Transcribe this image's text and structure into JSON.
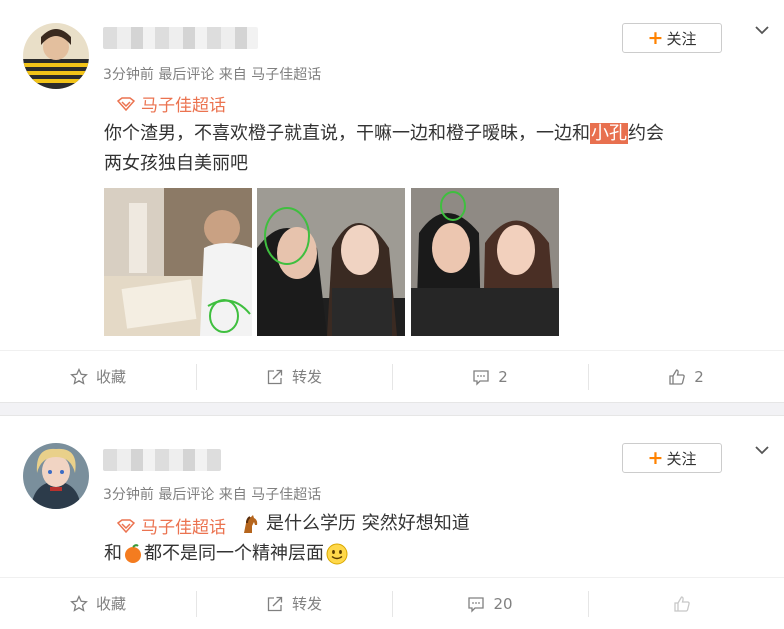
{
  "post1": {
    "meta": "3分钟前 最后评论 来自 马子佳超话",
    "follow_label": "关注",
    "topic": "马子佳超话",
    "text_line1_a": "你个渣男，不喜欢橙子就直说，干嘛一边和橙子暧昧，一边和",
    "text_line1_hl": "小孔",
    "text_line1_b": "约会",
    "text_line2": "两女孩独自美丽吧",
    "actions": {
      "collect": "收藏",
      "repost": "转发",
      "comment_count": "2",
      "like_count": "2"
    }
  },
  "post2": {
    "meta": "3分钟前 最后评论 来自 马子佳超话",
    "follow_label": "关注",
    "topic": "马子佳超话",
    "text_line1": "是什么学历 突然好想知道",
    "text_line2_a": "和",
    "text_line2_b": "都不是同一个精神层面",
    "actions": {
      "collect": "收藏",
      "repost": "转发",
      "comment_count": "20"
    }
  },
  "colors": {
    "accent": "#ff8200",
    "topic": "#eb7350",
    "highlight": "#e8704f"
  }
}
